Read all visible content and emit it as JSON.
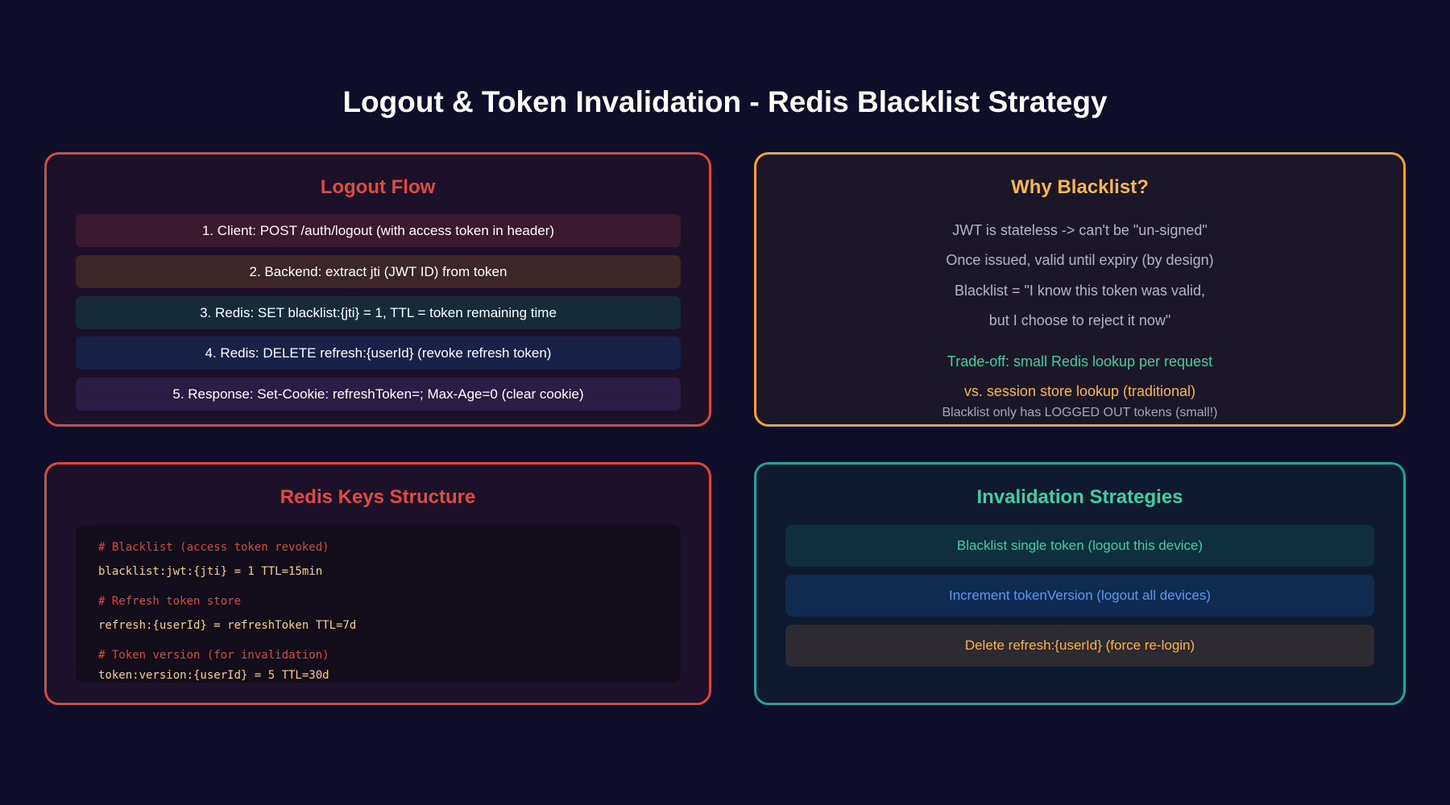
{
  "title": "Logout & Token Invalidation - Redis Blacklist Strategy",
  "logout_flow": {
    "heading": "Logout Flow",
    "steps": [
      "1. Client: POST /auth/logout (with access token in header)",
      "2. Backend: extract jti (JWT ID) from token",
      "3. Redis: SET blacklist:{jti} = 1, TTL = token remaining time",
      "4. Redis: DELETE refresh:{userId} (revoke refresh token)",
      "5. Response: Set-Cookie: refreshToken=; Max-Age=0 (clear cookie)"
    ]
  },
  "why_blacklist": {
    "heading": "Why Blacklist?",
    "lines": [
      "JWT is stateless -> can't be \"un-signed\"",
      "Once issued, valid until expiry (by design)",
      "Blacklist = \"I know this token was valid,",
      "but I choose to reject it now\""
    ],
    "tradeoff": [
      "Trade-off: small Redis lookup per request",
      "vs. session store lookup (traditional)"
    ],
    "note": "Blacklist only has LOGGED OUT tokens (small!)"
  },
  "redis_keys": {
    "heading": "Redis Keys Structure",
    "code_lines": [
      "# Blacklist (access token revoked)",
      "blacklist:jwt:{jti} = 1 TTL=15min",
      "# Refresh token store",
      "refresh:{userId} = refreshToken TTL=7d",
      "# Token version (for invalidation)",
      "token:version:{userId} = 5 TTL=30d"
    ]
  },
  "invalidation": {
    "heading": "Invalidation Strategies",
    "strategies": [
      "Blacklist single token (logout this device)",
      "Increment tokenVersion (logout all devices)",
      "Delete refresh:{userId} (force re-login)"
    ]
  },
  "colors": {
    "background": "#0f0e29",
    "red_accent": "#df4b42",
    "orange_accent": "#f2a42b",
    "teal_accent": "#22a39b",
    "green_text": "#3ecfa2",
    "blue_text": "#5b9ae8",
    "amber_text": "#f5b64d"
  }
}
